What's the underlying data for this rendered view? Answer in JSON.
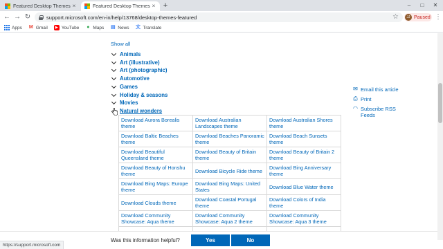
{
  "browser": {
    "tabs": [
      {
        "title": "Featured Desktop Themes - Win",
        "active": false
      },
      {
        "title": "Featured Desktop Themes - Win",
        "active": true
      }
    ],
    "new_tab": "+",
    "window_controls": {
      "minimize": "–",
      "maximize": "□",
      "close": "✕"
    },
    "url": "support.microsoft.com/en-in/help/13768/desktop-themes-featured",
    "profile_initials": "JJ",
    "profile_label": "Paused",
    "bookmarks": [
      {
        "label": "Apps",
        "icon": "apps-icon"
      },
      {
        "label": "Gmail",
        "icon": "gmail-icon"
      },
      {
        "label": "YouTube",
        "icon": "youtube-icon"
      },
      {
        "label": "Maps",
        "icon": "maps-icon"
      },
      {
        "label": "News",
        "icon": "news-icon"
      },
      {
        "label": "Translate",
        "icon": "translate-icon"
      }
    ],
    "status_url": "https://support.microsoft.com"
  },
  "content": {
    "show_all": "Show all",
    "categories": [
      {
        "label": "Animals",
        "expanded": false
      },
      {
        "label": "Art (illustrative)",
        "expanded": false
      },
      {
        "label": "Art (photographic)",
        "expanded": false
      },
      {
        "label": "Automotive",
        "expanded": false
      },
      {
        "label": "Games",
        "expanded": false
      },
      {
        "label": "Holiday & seasons",
        "expanded": false
      },
      {
        "label": "Movies",
        "expanded": false
      },
      {
        "label": "Natural wonders",
        "expanded": true
      }
    ],
    "theme_rows": [
      [
        "Download Aurora Borealis theme",
        "Download Australian Landscapes theme",
        "Download Australian Shores theme"
      ],
      [
        "Download Baltic Beaches theme",
        "Download Beaches Panoramic theme",
        "Download Beach Sunsets theme"
      ],
      [
        "Download Beautiful Queensland theme",
        "Download Beauty of Britain theme",
        "Download Beauty of Britain 2 theme"
      ],
      [
        "Download Beauty of Honshu theme",
        "Download Bicycle Ride theme",
        "Download Bing Anniversary theme"
      ],
      [
        "Download Bing Maps: Europe theme",
        "Download Bing Maps: United States",
        "Download Blue Water theme"
      ],
      [
        "Download Clouds theme",
        "Download Coastal Portugal theme",
        "Download Colors of India theme"
      ],
      [
        "Download Community Showcase: Aqua theme",
        "Download Community Showcase: Aqua 2 theme",
        "Download Community Showcase: Aqua 3 theme"
      ],
      [
        "",
        "",
        "Download Community"
      ]
    ]
  },
  "side_links": [
    {
      "label": "Email this article",
      "icon": "email-icon"
    },
    {
      "label": "Print",
      "icon": "print-icon"
    },
    {
      "label": "Subscribe RSS Feeds",
      "icon": "rss-icon"
    }
  ],
  "feedback": {
    "question": "Was this information helpful?",
    "yes": "Yes",
    "no": "No"
  },
  "colors": {
    "link": "#0067b8",
    "button": "#0067b8",
    "tab_strip": "#dee1e6"
  }
}
